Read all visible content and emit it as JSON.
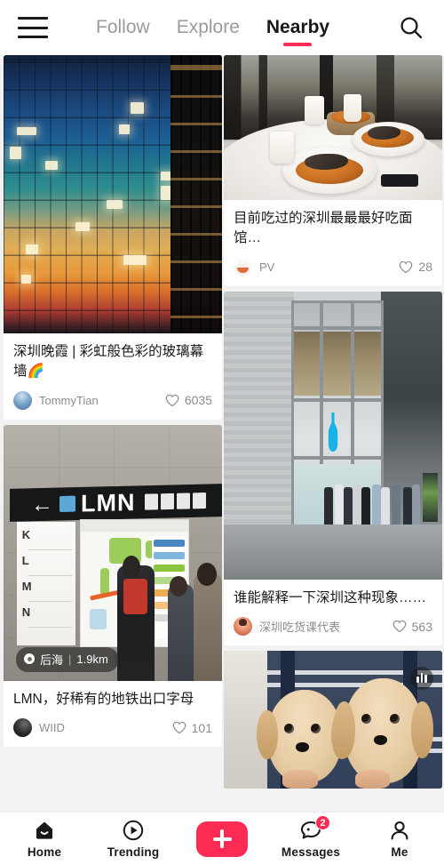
{
  "header": {
    "menu_icon": "hamburger-menu-icon",
    "search_icon": "search-icon",
    "tabs": [
      {
        "label": "Follow",
        "active": false
      },
      {
        "label": "Explore",
        "active": false
      },
      {
        "label": "Nearby",
        "active": true
      }
    ],
    "accent_color": "#fe2c55"
  },
  "feed": {
    "left_column": [
      {
        "id": "card-sunset-facade",
        "title": "深圳晚霞 | 彩虹般色彩的玻璃幕墙🌈",
        "author": "TommyTian",
        "likes": "6035",
        "avatar_name": "avatar-tommytian",
        "image_name": "glass-facade-sunset-photo"
      },
      {
        "id": "card-subway-exit",
        "title": "LMN，好稀有的地铁出口字母",
        "author": "WIID",
        "likes": "101",
        "avatar_name": "avatar-wiid",
        "image_name": "subway-exit-sign-photo",
        "location": {
          "name": "后海",
          "distance": "1.9km",
          "separator": "|"
        }
      }
    ],
    "right_column": [
      {
        "id": "card-noodle-restaurant",
        "title": "目前吃过的深圳最最最好吃面馆…",
        "author": "PV",
        "likes": "28",
        "avatar_name": "avatar-pv",
        "image_name": "restaurant-noodles-photo"
      },
      {
        "id": "card-blue-bottle",
        "title": "谁能解释一下深圳这种现象……",
        "author": "深圳吃货课代表",
        "likes": "563",
        "avatar_name": "avatar-shenzhen-foodie",
        "image_name": "blue-bottle-storefront-photo"
      },
      {
        "id": "card-puppies",
        "title": "",
        "author": "",
        "likes": "",
        "image_name": "two-puppies-photo",
        "badge": "chart-bars-icon"
      }
    ]
  },
  "bottom_nav": {
    "items": [
      {
        "label": "Home",
        "icon": "home-icon",
        "active": true
      },
      {
        "label": "Trending",
        "icon": "play-circle-icon",
        "active": false
      },
      {
        "label": "",
        "icon": "plus-icon",
        "is_plus": true
      },
      {
        "label": "Messages",
        "icon": "chat-bubble-icon",
        "badge": "2",
        "active": false
      },
      {
        "label": "Me",
        "icon": "person-icon",
        "active": false
      }
    ]
  },
  "subway_sign": {
    "letters": "LMN",
    "arrow": "←",
    "panel_letters": [
      "K",
      "L",
      "M",
      "N"
    ]
  }
}
